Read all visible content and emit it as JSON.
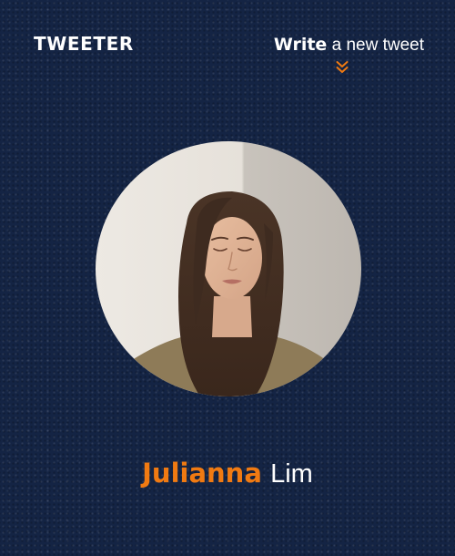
{
  "header": {
    "brand": "TWEETER",
    "write_link_bold": "Write",
    "write_link_rest": " a new tweet",
    "write_icon": "chevron-double-down-icon"
  },
  "profile": {
    "avatar_icon": "profile-photo",
    "first_name": "Julianna",
    "last_name": "Lim"
  },
  "colors": {
    "background": "#142444",
    "accent": "#f07a12",
    "text": "#ffffff"
  }
}
